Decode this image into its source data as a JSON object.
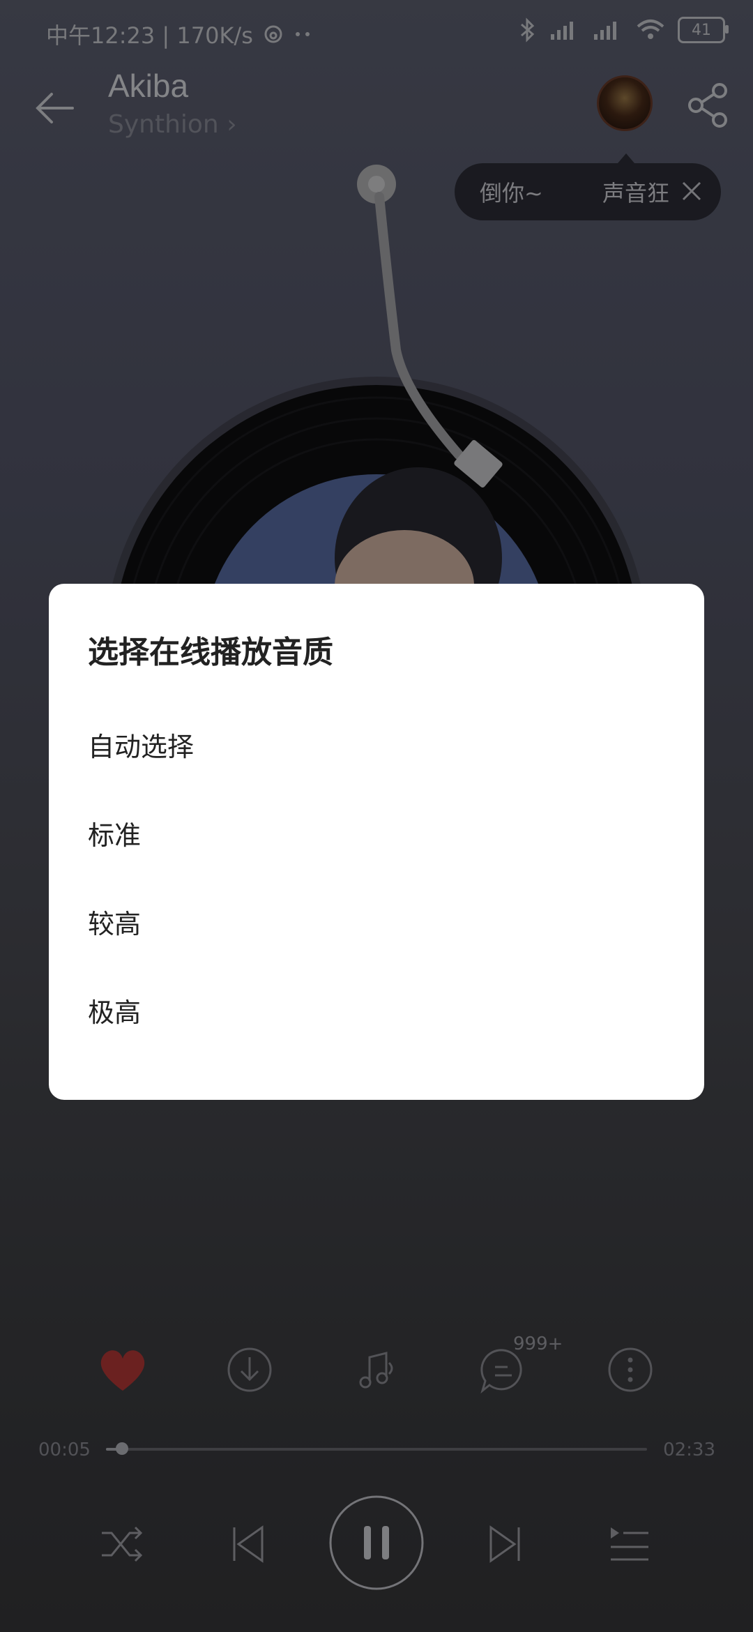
{
  "status_bar": {
    "time": "中午12:23 | 170K/s",
    "battery": "41",
    "icons": [
      "netease-icon",
      "more-dots-icon",
      "bluetooth-icon",
      "signal-icon",
      "signal-icon",
      "wifi-icon",
      "battery-icon"
    ]
  },
  "header": {
    "title": "Akiba",
    "subtitle": "Synthion",
    "back_icon": "back-arrow-icon",
    "share_icon": "share-icon"
  },
  "tip": {
    "text1": "倒你~",
    "text2": "声音狂",
    "close_icon": "close-icon"
  },
  "dialog": {
    "title": "选择在线播放音质",
    "options": [
      "自动选择",
      "标准",
      "较高",
      "极高"
    ]
  },
  "actions": {
    "comment_count": "999+",
    "icons": [
      "heart-icon",
      "download-icon",
      "ringtone-icon",
      "comment-icon",
      "more-icon"
    ]
  },
  "progress": {
    "current": "00:05",
    "total": "02:33",
    "fraction": 0.03
  },
  "colors": {
    "heart": "#d6403e",
    "dialog_bg": "#ffffff",
    "text_dark": "#222222"
  }
}
